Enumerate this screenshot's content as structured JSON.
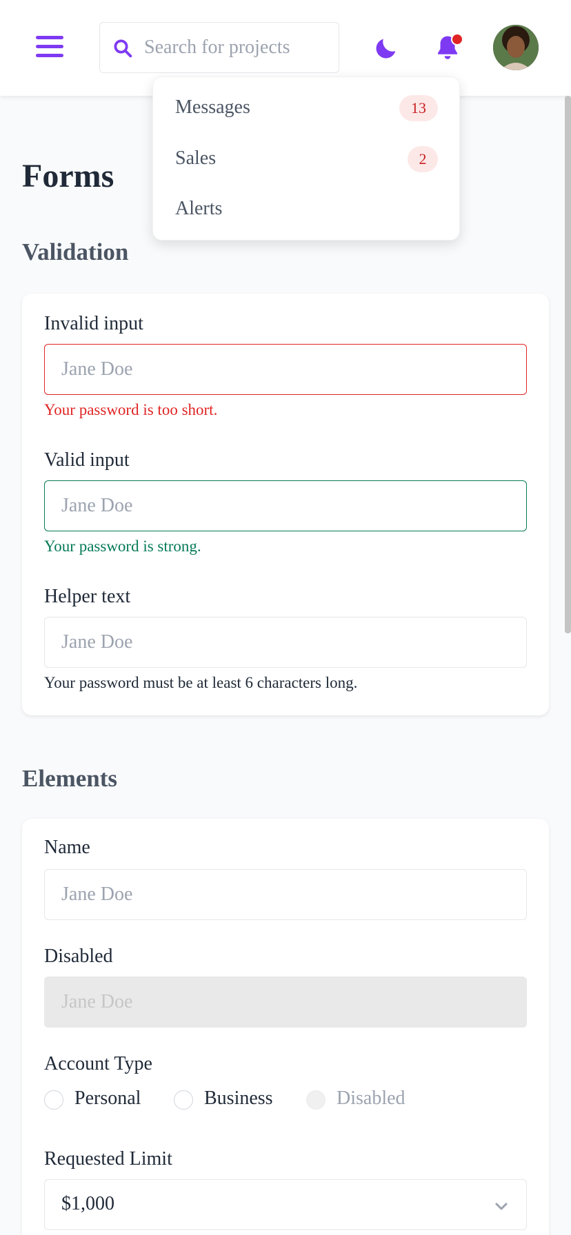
{
  "header": {
    "search_placeholder": "Search for projects",
    "accent_color": "#7e3af2",
    "notification_dot_color": "#e02424"
  },
  "dropdown": {
    "items": [
      {
        "label": "Messages",
        "badge": "13"
      },
      {
        "label": "Sales",
        "badge": "2"
      },
      {
        "label": "Alerts",
        "badge": ""
      }
    ]
  },
  "page": {
    "title": "Forms"
  },
  "validation": {
    "title": "Validation",
    "invalid": {
      "label": "Invalid input",
      "placeholder": "Jane Doe",
      "message": "Your password is too short."
    },
    "valid": {
      "label": "Valid input",
      "placeholder": "Jane Doe",
      "message": "Your password is strong."
    },
    "helper": {
      "label": "Helper text",
      "placeholder": "Jane Doe",
      "message": "Your password must be at least 6 characters long."
    }
  },
  "elements": {
    "title": "Elements",
    "name": {
      "label": "Name",
      "placeholder": "Jane Doe"
    },
    "disabled": {
      "label": "Disabled",
      "placeholder": "Jane Doe"
    },
    "account_type": {
      "label": "Account Type",
      "options": [
        "Personal",
        "Business",
        "Disabled"
      ]
    },
    "requested_limit": {
      "label": "Requested Limit",
      "value": "$1,000"
    }
  },
  "icons": {
    "menu": "hamburger-menu-icon",
    "search": "search-icon",
    "theme": "moon-icon",
    "notifications": "bell-icon",
    "select": "chevron-down-icon"
  }
}
